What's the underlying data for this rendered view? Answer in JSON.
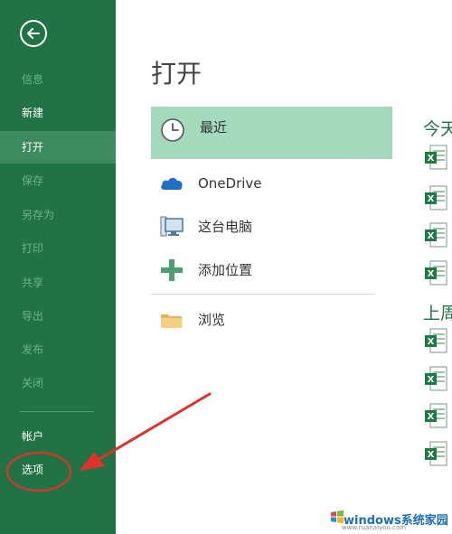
{
  "sidebar": {
    "items": [
      {
        "label": "信息"
      },
      {
        "label": "新建"
      },
      {
        "label": "打开"
      },
      {
        "label": "保存"
      },
      {
        "label": "另存为"
      },
      {
        "label": "打印"
      },
      {
        "label": "共享"
      },
      {
        "label": "导出"
      },
      {
        "label": "发布"
      },
      {
        "label": "关闭"
      },
      {
        "label": "帐户"
      },
      {
        "label": "选项"
      }
    ]
  },
  "main": {
    "title": "打开",
    "locations": [
      {
        "label": "最近",
        "icon": "clock-icon"
      },
      {
        "label": "OneDrive",
        "icon": "cloud-icon"
      },
      {
        "label": "这台电脑",
        "icon": "computer-icon"
      },
      {
        "label": "添加位置",
        "icon": "plus-icon"
      },
      {
        "label": "浏览",
        "icon": "folder-icon"
      }
    ],
    "groups": [
      {
        "label": "今天"
      },
      {
        "label": "上周"
      }
    ]
  },
  "watermark": {
    "text": "windows系统家园",
    "url": "www.ruanaiyou.com"
  },
  "colors": {
    "sidebar": "#217346",
    "selected": "#3c8a5d",
    "recent_highlight": "#a3d9bd",
    "annotation": "#e0322b"
  }
}
